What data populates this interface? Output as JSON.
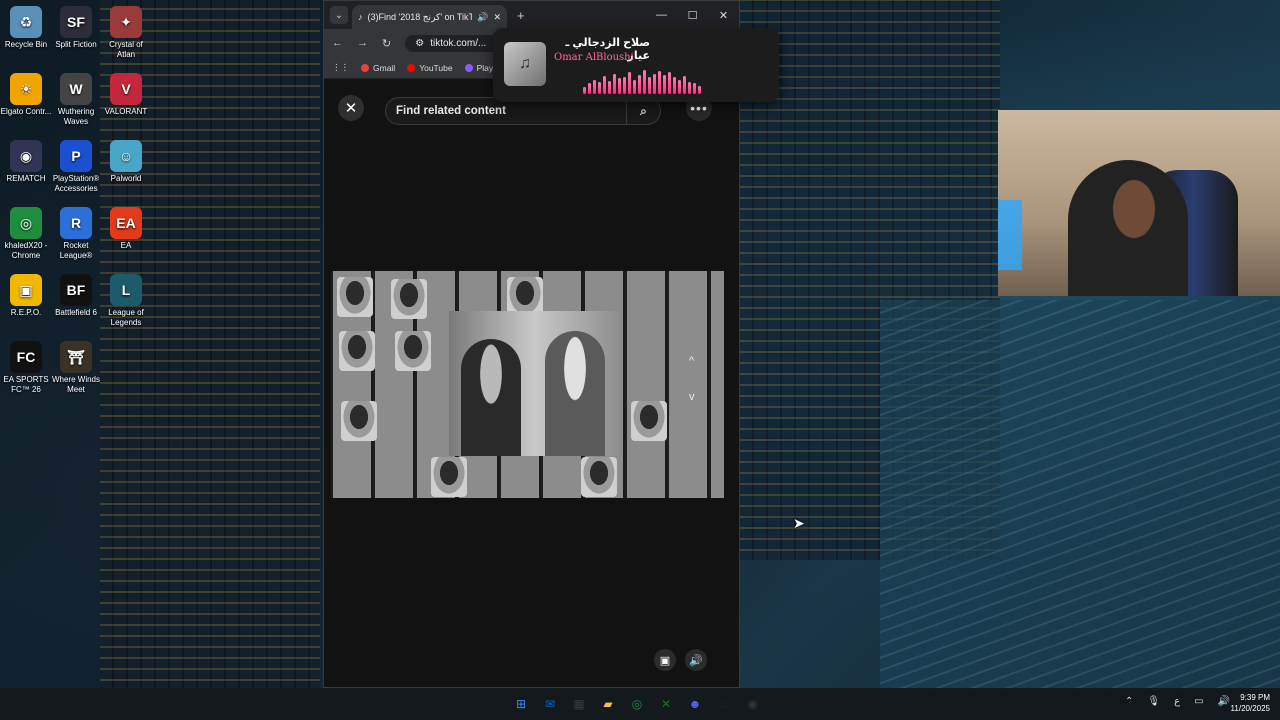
{
  "desktop": {
    "icons": [
      {
        "name": "recycle-bin-icon",
        "label": "Recycle Bin",
        "glyph": "♻",
        "color": "#5a8fb8"
      },
      {
        "name": "split-fiction-icon",
        "label": "Split Fiction",
        "glyph": "SF",
        "color": "#2c2c3a"
      },
      {
        "name": "crystal-of-atlan-icon",
        "label": "Crystal of Atlan",
        "glyph": "✦",
        "color": "#9b3a3a"
      },
      {
        "name": "elgato-control-icon",
        "label": "Elgato Contr...",
        "glyph": "☀",
        "color": "#f0a400"
      },
      {
        "name": "wuthering-waves-icon",
        "label": "Wuthering Waves",
        "glyph": "W",
        "color": "#444"
      },
      {
        "name": "valorant-icon",
        "label": "VALORANT",
        "glyph": "V",
        "color": "#c4273b"
      },
      {
        "name": "rematch-icon",
        "label": "REMATCH",
        "glyph": "◉",
        "color": "#335"
      },
      {
        "name": "playstation-accessories-icon",
        "label": "PlayStation® Accessories",
        "glyph": "P",
        "color": "#1a4fd1"
      },
      {
        "name": "palworld-icon",
        "label": "Palworld",
        "glyph": "☺",
        "color": "#48a6c9"
      },
      {
        "name": "chrome-icon",
        "label": "khaledX20 - Chrome",
        "glyph": "◎",
        "color": "#1e8e3e"
      },
      {
        "name": "rocket-league-icon",
        "label": "Rocket League®",
        "glyph": "R",
        "color": "#2c6fd8"
      },
      {
        "name": "ea-icon",
        "label": "EA",
        "glyph": "EA",
        "color": "#e23a1b"
      },
      {
        "name": "repo-icon",
        "label": "R.E.P.O.",
        "glyph": "▣",
        "color": "#f2b700"
      },
      {
        "name": "battlefield-6-icon",
        "label": "Battlefield 6",
        "glyph": "BF",
        "color": "#111"
      },
      {
        "name": "league-of-legends-icon",
        "label": "League of Legends",
        "glyph": "L",
        "color": "#1c5b6b"
      },
      {
        "name": "ea-sports-fc-icon",
        "label": "EA SPORTS FC™ 26",
        "glyph": "FC",
        "color": "#111"
      },
      {
        "name": "where-winds-meet-icon",
        "label": "Where Winds Meet",
        "glyph": "⛩",
        "color": "#3a3226"
      }
    ]
  },
  "browser": {
    "tab_title": "(3)Find '2018 كرنج' on TikTo...",
    "url": "tiktok.com/...",
    "bookmarks": [
      {
        "label": "Gmail",
        "color": "#ea4335"
      },
      {
        "label": "YouTube",
        "color": "#ff0000"
      },
      {
        "label": "Play",
        "color": "#8a5cff"
      }
    ],
    "search_placeholder": "Find related content",
    "nav_up": "^",
    "nav_down": "v"
  },
  "now_playing": {
    "title": "صلاح الزدجالي ـ عيار",
    "artist": "Omar AlBloushi",
    "art_glyph": "♫",
    "eq_levels": [
      0.3,
      0.45,
      0.6,
      0.5,
      0.75,
      0.55,
      0.85,
      0.65,
      0.7,
      0.9,
      0.6,
      0.8,
      1.0,
      0.7,
      0.85,
      0.95,
      0.8,
      0.9,
      0.7,
      0.6,
      0.75,
      0.5,
      0.45,
      0.35
    ],
    "accent": "#ff3d86"
  },
  "taskbar": {
    "apps": [
      {
        "name": "start-icon",
        "glyph": "⊞",
        "color": "#2b8cff"
      },
      {
        "name": "outlook-icon",
        "glyph": "✉",
        "color": "#0a64c2"
      },
      {
        "name": "store-icon",
        "glyph": "▦",
        "color": "#3a3a3a"
      },
      {
        "name": "file-explorer-icon",
        "glyph": "▰",
        "color": "#f2c14e"
      },
      {
        "name": "chrome-taskbar-icon",
        "glyph": "◎",
        "color": "#1e8e3e"
      },
      {
        "name": "xbox-icon",
        "glyph": "✕",
        "color": "#107c10"
      },
      {
        "name": "discord-icon",
        "glyph": "☻",
        "color": "#5865f2"
      },
      {
        "name": "steam-icon",
        "glyph": "♨",
        "color": "#1b2838"
      },
      {
        "name": "recording-icon",
        "glyph": "◉",
        "color": "#333"
      }
    ],
    "tray_lang": "ع",
    "time": "9:39 PM",
    "date": "11/20/2025"
  }
}
